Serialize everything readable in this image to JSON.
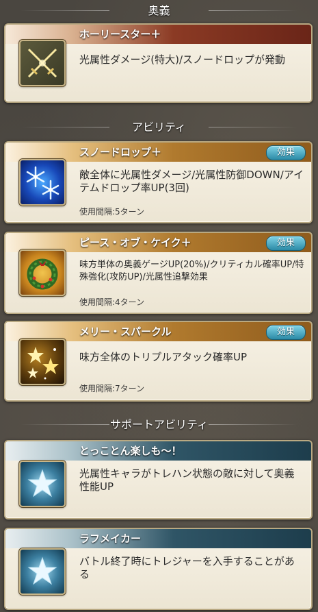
{
  "sections": {
    "ougi": "奥義",
    "abilities": "アビリティ",
    "support": "サポートアビリティ"
  },
  "ougi": {
    "name": "ホーリースター＋",
    "description": "光属性ダメージ(特大)/スノードロップが発動",
    "icon": "crossed-swords-icon"
  },
  "abilities": [
    {
      "name": "スノードロップ＋",
      "effect_label": "効果",
      "description": "敵全体に光属性ダメージ/光属性防御DOWN/アイテムドロップ率UP(3回)",
      "cooldown": "使用間隔:5ターン",
      "icon": "snowflake-icon"
    },
    {
      "name": "ピース・オブ・ケイク＋",
      "effect_label": "効果",
      "description": "味方単体の奥義ゲージUP(20%)/クリティカル確率UP/特殊強化(攻防UP)/光属性追撃効果",
      "cooldown": "使用間隔:4ターン",
      "icon": "christmas-wreath-icon"
    },
    {
      "name": "メリー・スパークル",
      "effect_label": "効果",
      "description": "味方全体のトリプルアタック確率UP",
      "cooldown": "使用間隔:7ターン",
      "icon": "sparkle-stars-icon"
    }
  ],
  "support": [
    {
      "name": "とっことん楽しも〜！",
      "description": "光属性キャラがトレハン状態の敵に対して奥義性能UP",
      "icon": "star-icon"
    },
    {
      "name": "ラフメイカー",
      "description": "バトル終了時にトレジャーを入手することがある",
      "icon": "star-icon"
    }
  ],
  "colors": {
    "ougi_title": "#8b3a24",
    "ability_title": "#b07a2e",
    "support_title": "#2f5566",
    "effect_button": "#2b8aa6"
  }
}
